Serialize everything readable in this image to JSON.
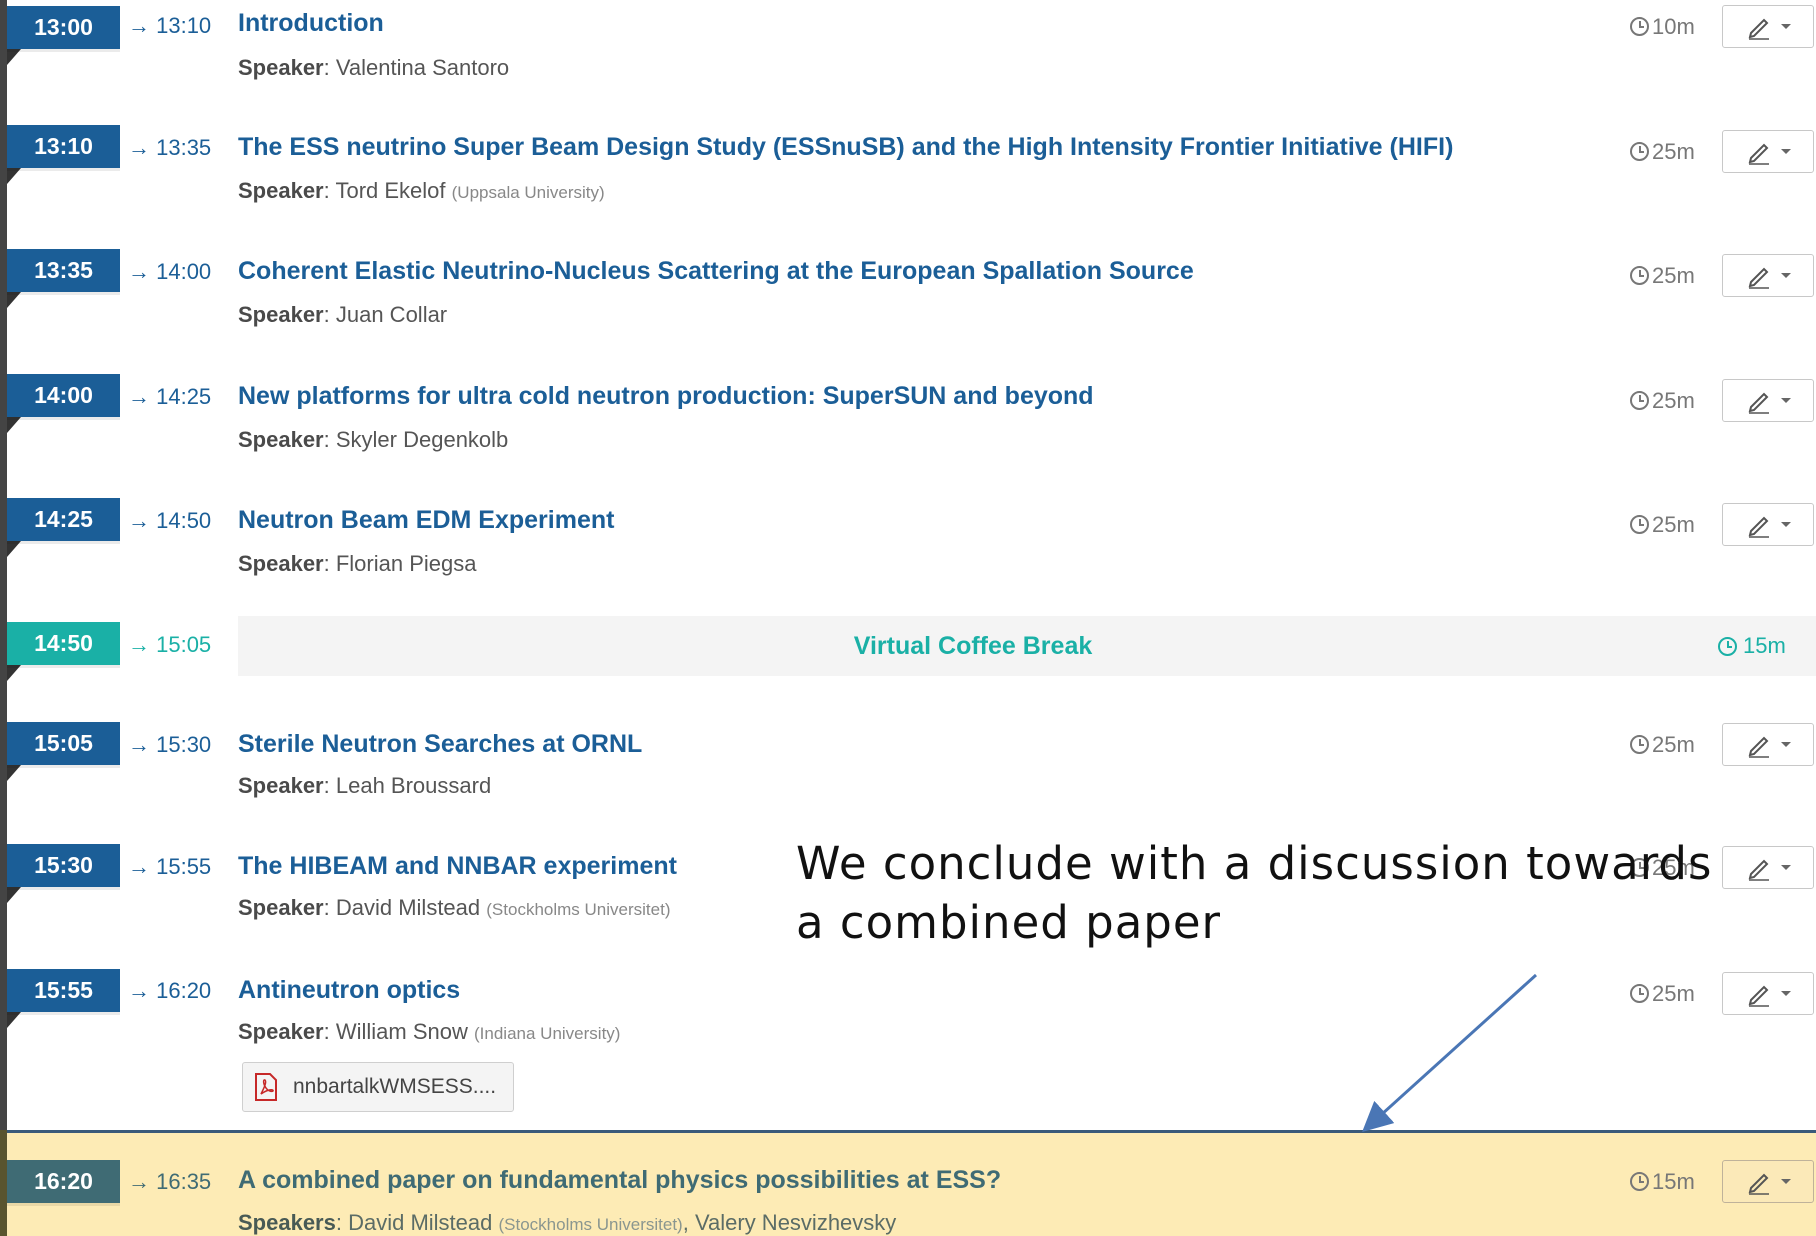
{
  "contributions": [
    {
      "start": "13:00",
      "end": "→ 13:10",
      "title": "Introduction",
      "speaker_label": "Speaker",
      "speaker": "Valentina Santoro",
      "affiliation": "",
      "duration": "10m"
    },
    {
      "start": "13:10",
      "end": "→ 13:35",
      "title": "The ESS neutrino Super Beam Design Study (ESSnuSB) and the High Intensity Frontier Initiative (HIFI)",
      "speaker_label": "Speaker",
      "speaker": "Tord Ekelof",
      "affiliation": "(Uppsala University)",
      "duration": "25m"
    },
    {
      "start": "13:35",
      "end": "→ 14:00",
      "title": "Coherent Elastic Neutrino-Nucleus Scattering at the European Spallation Source",
      "speaker_label": "Speaker",
      "speaker": "Juan Collar",
      "affiliation": "",
      "duration": "25m"
    },
    {
      "start": "14:00",
      "end": "→ 14:25",
      "title": "New platforms for ultra cold neutron production: SuperSUN and beyond",
      "speaker_label": "Speaker",
      "speaker": "Skyler Degenkolb",
      "affiliation": "",
      "duration": "25m"
    },
    {
      "start": "14:25",
      "end": "→ 14:50",
      "title": "Neutron Beam EDM Experiment",
      "speaker_label": "Speaker",
      "speaker": "Florian Piegsa",
      "affiliation": "",
      "duration": "25m"
    },
    {
      "start": "15:05",
      "end": "→ 15:30",
      "title": "Sterile Neutron Searches at ORNL",
      "speaker_label": "Speaker",
      "speaker": "Leah Broussard",
      "affiliation": "",
      "duration": "25m"
    },
    {
      "start": "15:30",
      "end": "→ 15:55",
      "title": "The HIBEAM and NNBAR experiment",
      "speaker_label": "Speaker",
      "speaker": "David Milstead",
      "affiliation": "(Stockholms Universitet)",
      "duration": "25m"
    },
    {
      "start": "15:55",
      "end": "→ 16:20",
      "title": "Antineutron optics",
      "speaker_label": "Speaker",
      "speaker": "William Snow",
      "affiliation": "(Indiana University)",
      "duration": "25m"
    }
  ],
  "break": {
    "start": "14:50",
    "end": "→ 15:05",
    "title": "Virtual Coffee Break",
    "duration": "15m"
  },
  "attachment": {
    "filename": "nnbartalkWMSESS...."
  },
  "highlighted": {
    "start": "16:20",
    "end": "→ 16:35",
    "title": "A combined paper on fundamental physics possibilities at ESS?",
    "speakers_label": "Speakers",
    "speaker1": "David Milstead",
    "affiliation1": "(Stockholms Universitet)",
    "separator": ",",
    "speaker2": "Valery Nesvizhevsky",
    "duration": "15m"
  },
  "annotation": {
    "text": "We conclude with a discussion towards\na combined  paper"
  },
  "icons": {
    "edit": "pencil-icon",
    "dropdown": "caret-down-icon",
    "clock": "clock-icon",
    "file": "pdf-icon"
  },
  "colors": {
    "primary": "#1b5e97",
    "break": "#1ab0a6",
    "highlight": "#fdebb5",
    "timeline": "#444444"
  }
}
